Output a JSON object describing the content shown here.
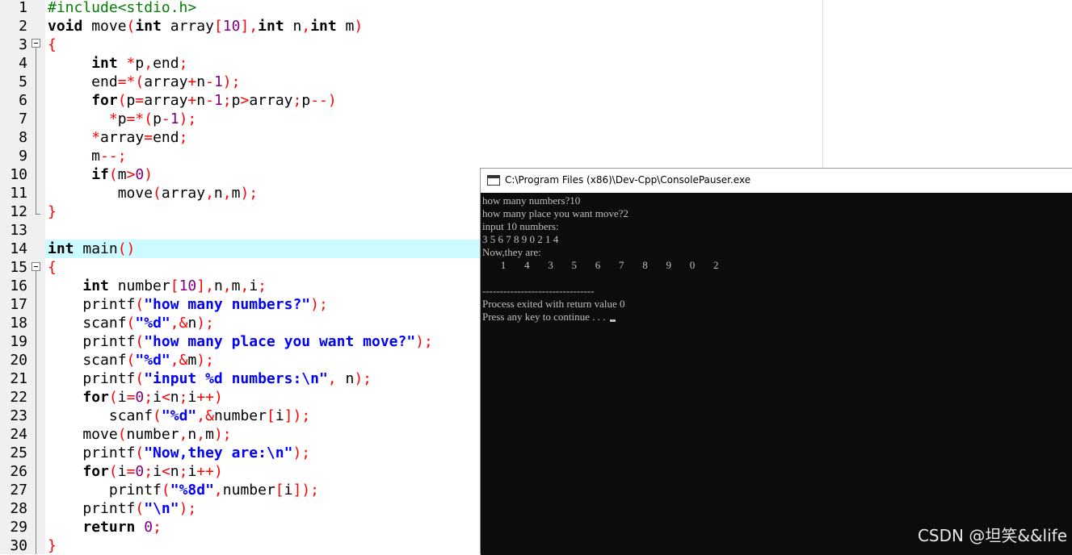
{
  "editor": {
    "lines": [
      {
        "n": "1",
        "html": "<span class=\"pp\">#include&lt;stdio.h&gt;</span>"
      },
      {
        "n": "2",
        "html": "<span class=\"kw\">void</span> move<span class=\"op\">(</span><span class=\"kw\">int</span> array<span class=\"op\">[</span><span class=\"num\">10</span><span class=\"op\">],</span><span class=\"kw\">int</span> n<span class=\"op\">,</span><span class=\"kw\">int</span> m<span class=\"op\">)</span>"
      },
      {
        "n": "3",
        "html": "<span class=\"op\">{</span>"
      },
      {
        "n": "4",
        "html": "     <span class=\"kw\">int</span> <span class=\"op\">*</span>p<span class=\"op\">,</span>end<span class=\"op\">;</span>"
      },
      {
        "n": "5",
        "html": "     end<span class=\"op\">=*(</span>array<span class=\"op\">+</span>n<span class=\"op\">-</span><span class=\"num\">1</span><span class=\"op\">);</span>"
      },
      {
        "n": "6",
        "html": "     <span class=\"kw\">for</span><span class=\"op\">(</span>p<span class=\"op\">=</span>array<span class=\"op\">+</span>n<span class=\"op\">-</span><span class=\"num\">1</span><span class=\"op\">;</span>p<span class=\"op\">&gt;</span>array<span class=\"op\">;</span>p<span class=\"op\">--)</span>"
      },
      {
        "n": "7",
        "html": "       <span class=\"op\">*</span>p<span class=\"op\">=*(</span>p<span class=\"op\">-</span><span class=\"num\">1</span><span class=\"op\">);</span>"
      },
      {
        "n": "8",
        "html": "     <span class=\"op\">*</span>array<span class=\"op\">=</span>end<span class=\"op\">;</span>"
      },
      {
        "n": "9",
        "html": "     m<span class=\"op\">--;</span>"
      },
      {
        "n": "10",
        "html": "     <span class=\"kw\">if</span><span class=\"op\">(</span>m<span class=\"op\">&gt;</span><span class=\"num\">0</span><span class=\"op\">)</span>"
      },
      {
        "n": "11",
        "html": "        move<span class=\"op\">(</span>array<span class=\"op\">,</span>n<span class=\"op\">,</span>m<span class=\"op\">);</span>"
      },
      {
        "n": "12",
        "html": "<span class=\"op\">}</span>"
      },
      {
        "n": "13",
        "html": ""
      },
      {
        "n": "14",
        "html": "<span class=\"kw\">int</span> main<span class=\"op\">()</span>"
      },
      {
        "n": "15",
        "html": "<span class=\"op\">{</span>"
      },
      {
        "n": "16",
        "html": "    <span class=\"kw\">int</span> number<span class=\"op\">[</span><span class=\"num\">10</span><span class=\"op\">],</span>n<span class=\"op\">,</span>m<span class=\"op\">,</span>i<span class=\"op\">;</span>"
      },
      {
        "n": "17",
        "html": "    printf<span class=\"op\">(</span><span class=\"str\">\"how many numbers?\"</span><span class=\"op\">);</span>"
      },
      {
        "n": "18",
        "html": "    scanf<span class=\"op\">(</span><span class=\"str\">\"%d\"</span><span class=\"op\">,&amp;</span>n<span class=\"op\">);</span>"
      },
      {
        "n": "19",
        "html": "    printf<span class=\"op\">(</span><span class=\"str\">\"how many place you want move?\"</span><span class=\"op\">);</span>"
      },
      {
        "n": "20",
        "html": "    scanf<span class=\"op\">(</span><span class=\"str\">\"%d\"</span><span class=\"op\">,&amp;</span>m<span class=\"op\">);</span>"
      },
      {
        "n": "21",
        "html": "    printf<span class=\"op\">(</span><span class=\"str\">\"input %d numbers:\\n\"</span><span class=\"op\">,</span> n<span class=\"op\">);</span>"
      },
      {
        "n": "22",
        "html": "    <span class=\"kw\">for</span><span class=\"op\">(</span>i<span class=\"op\">=</span><span class=\"num\">0</span><span class=\"op\">;</span>i<span class=\"op\">&lt;</span>n<span class=\"op\">;</span>i<span class=\"op\">++)</span>"
      },
      {
        "n": "23",
        "html": "       scanf<span class=\"op\">(</span><span class=\"str\">\"%d\"</span><span class=\"op\">,&amp;</span>number<span class=\"op\">[</span>i<span class=\"op\">]);</span>"
      },
      {
        "n": "24",
        "html": "    move<span class=\"op\">(</span>number<span class=\"op\">,</span>n<span class=\"op\">,</span>m<span class=\"op\">);</span>"
      },
      {
        "n": "25",
        "html": "    printf<span class=\"op\">(</span><span class=\"str\">\"Now,they are:\\n\"</span><span class=\"op\">);</span>"
      },
      {
        "n": "26",
        "html": "    <span class=\"kw\">for</span><span class=\"op\">(</span>i<span class=\"op\">=</span><span class=\"num\">0</span><span class=\"op\">;</span>i<span class=\"op\">&lt;</span>n<span class=\"op\">;</span>i<span class=\"op\">++)</span>"
      },
      {
        "n": "27",
        "html": "       printf<span class=\"op\">(</span><span class=\"str\">\"%8d\"</span><span class=\"op\">,</span>number<span class=\"op\">[</span>i<span class=\"op\">]);</span>"
      },
      {
        "n": "28",
        "html": "    printf<span class=\"op\">(</span><span class=\"str\">\"\\n\"</span><span class=\"op\">);</span>"
      },
      {
        "n": "29",
        "html": "    <span class=\"kw\">return</span> <span class=\"num\">0</span><span class=\"op\">;</span>"
      },
      {
        "n": "30",
        "html": "<span class=\"op\">}</span>"
      }
    ]
  },
  "console": {
    "title": "C:\\Program Files (x86)\\Dev-Cpp\\ConsolePauser.exe",
    "lines": [
      "how many numbers?10",
      "how many place you want move?2",
      "input 10 numbers:",
      "3 5 6 7 8 9 0 2 1 4",
      "Now,they are:",
      "       1       4       3       5       6       7       8       9       0       2",
      "",
      "--------------------------------",
      "Process exited with return value 0",
      "Press any key to continue . . . "
    ]
  },
  "watermark": "CSDN @坦笑&&life"
}
